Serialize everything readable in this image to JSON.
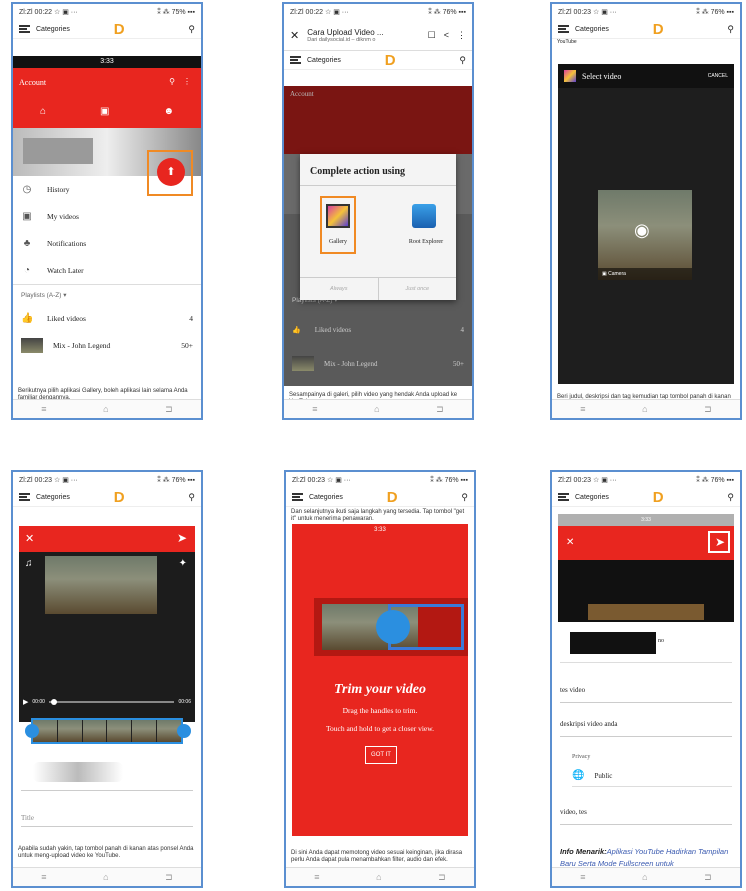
{
  "common": {
    "status_left_a": "Zl:Zl 00:22 ☆ ▣ ···",
    "status_left_b": "Zl:Zl 00:23 ☆ ▣ ···",
    "status_right_a": "⁑ ⁂ 75% ▪▪▪",
    "status_right_b": "⁑ ⁂ 76% ▪▪▪",
    "categories": "Categories",
    "logo": "D",
    "nav_menu": "≡",
    "nav_home": "⌂",
    "nav_back": "⊐"
  },
  "p1": {
    "inner_time": "3:33",
    "account": "Account",
    "menu": [
      {
        "icon": "history-icon",
        "glyph": "◷",
        "label": "History"
      },
      {
        "icon": "my-videos-icon",
        "glyph": "▣",
        "label": "My videos"
      },
      {
        "icon": "bell-icon",
        "glyph": "♣",
        "label": "Notifications"
      },
      {
        "icon": "clock-icon",
        "glyph": "◔",
        "label": "Watch Later"
      }
    ],
    "playlists": "Playlists (A-Z) ▾",
    "liked": "Liked videos",
    "liked_count": "4",
    "mix": "Mix - John Legend",
    "mix_count": "50+",
    "caption": "Berikutnya pilih aplikasi Gallery, boleh aplikasi lain selama Anda familiar dengannya."
  },
  "p2": {
    "title": "Cara Upload Video ...",
    "subtitle": "Dari dailysocial.id – diknm o",
    "account": "Account",
    "dialog_title": "Complete action using",
    "gallery": "Gallery",
    "root_explorer": "Root Explorer",
    "always": "Always",
    "just_once": "Just once",
    "playlists": "Playlists (A-Z) ▾",
    "liked": "Liked videos",
    "liked_count": "4",
    "mix": "Mix - John Legend",
    "mix_count": "50+",
    "caption": "Sesampainya di galeri, pilih video yang hendak Anda upload ke YouTube."
  },
  "p3": {
    "youtube": "YouTube",
    "select_video": "Select video",
    "cancel": "CANCEL",
    "camera": "Camera",
    "caption": "Beri judul, deskripsi dan tag kemudian tap tombol panah di kanan atas layar ponsel."
  },
  "p4": {
    "time_start": "00:00",
    "time_end": "00:06",
    "title_placeholder": "Title",
    "caption": "Apabila sudah yakin, tap tombol panah di kanan atas ponsel Anda untuk meng-upload video ke YouTube."
  },
  "p5": {
    "top_text": "Dan selanjutnya ikuti saja langkah yang tersedia. Tap tombol \"get it\" untuk menerima penawaran.",
    "inner_time": "3:33",
    "trim_title": "Trim your video",
    "trim_line1": "Drag the handles to trim.",
    "trim_line2": "Touch and hold to get a closer view.",
    "got_it": "GOT IT",
    "caption": "Di sini Anda dapat memotong video sesuai keinginan, jika dirasa perlu Anda dapat pula menambahkan filter, audio dan efek."
  },
  "p6": {
    "inner_time": "3:33",
    "title_suffix": "no",
    "field1": "tes video",
    "field2": "deskripsi video anda",
    "privacy_label": "Privacy",
    "privacy_value": "Public",
    "tags": "video, tes",
    "info_label": "Info Menarik:",
    "info_link": "Aplikasi YouTube Hadirkan Tampilan Baru Serta Mode Fullscreen untuk"
  },
  "colors": {
    "accent": "#e8261f",
    "border": "#5b8fd0",
    "highlight": "#f08a24",
    "handle": "#2b8fe0"
  }
}
